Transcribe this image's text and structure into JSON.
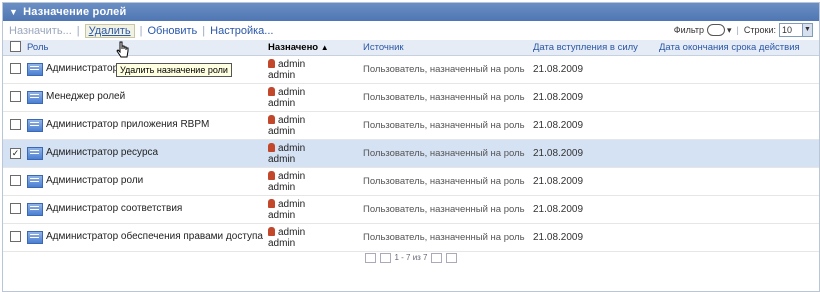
{
  "panel": {
    "title": "Назначение ролей"
  },
  "toolbar": {
    "assign": "Назначить...",
    "delete": "Удалить",
    "refresh": "Обновить",
    "settings": "Настройка...",
    "filter_label": "Фильтр",
    "rows_label": "Строки:",
    "rows_value": "10"
  },
  "tooltip": "Удалить назначение роли",
  "columns": {
    "role": "Роль",
    "assigned": "Назначено",
    "source": "Источник",
    "effective": "Дата вступления в силу",
    "expiry": "Дата окончания срока действия"
  },
  "rows": [
    {
      "role": "Администратор безопасности",
      "user1": "admin",
      "user2": "admin",
      "source": "Пользователь, назначенный на роль",
      "date": "21.08.2009",
      "checked": false
    },
    {
      "role": "Менеджер ролей",
      "user1": "admin",
      "user2": "admin",
      "source": "Пользователь, назначенный на роль",
      "date": "21.08.2009",
      "checked": false
    },
    {
      "role": "Администратор приложения RBPM",
      "user1": "admin",
      "user2": "admin",
      "source": "Пользователь, назначенный на роль",
      "date": "21.08.2009",
      "checked": false
    },
    {
      "role": "Администратор ресурса",
      "user1": "admin",
      "user2": "admin",
      "source": "Пользователь, назначенный на роль",
      "date": "21.08.2009",
      "checked": true
    },
    {
      "role": "Администратор роли",
      "user1": "admin",
      "user2": "admin",
      "source": "Пользователь, назначенный на роль",
      "date": "21.08.2009",
      "checked": false
    },
    {
      "role": "Администратор соответствия",
      "user1": "admin",
      "user2": "admin",
      "source": "Пользователь, назначенный на роль",
      "date": "21.08.2009",
      "checked": false
    },
    {
      "role": "Администратор обеспечения правами доступа",
      "user1": "admin",
      "user2": "admin",
      "source": "Пользователь, назначенный на роль",
      "date": "21.08.2009",
      "checked": false
    }
  ],
  "pager": {
    "text": "1 - 7 из 7"
  },
  "colors": {
    "title_bar": "#4f76b3",
    "selected_row": "#d5e2f3",
    "link": "#2a57a8"
  }
}
